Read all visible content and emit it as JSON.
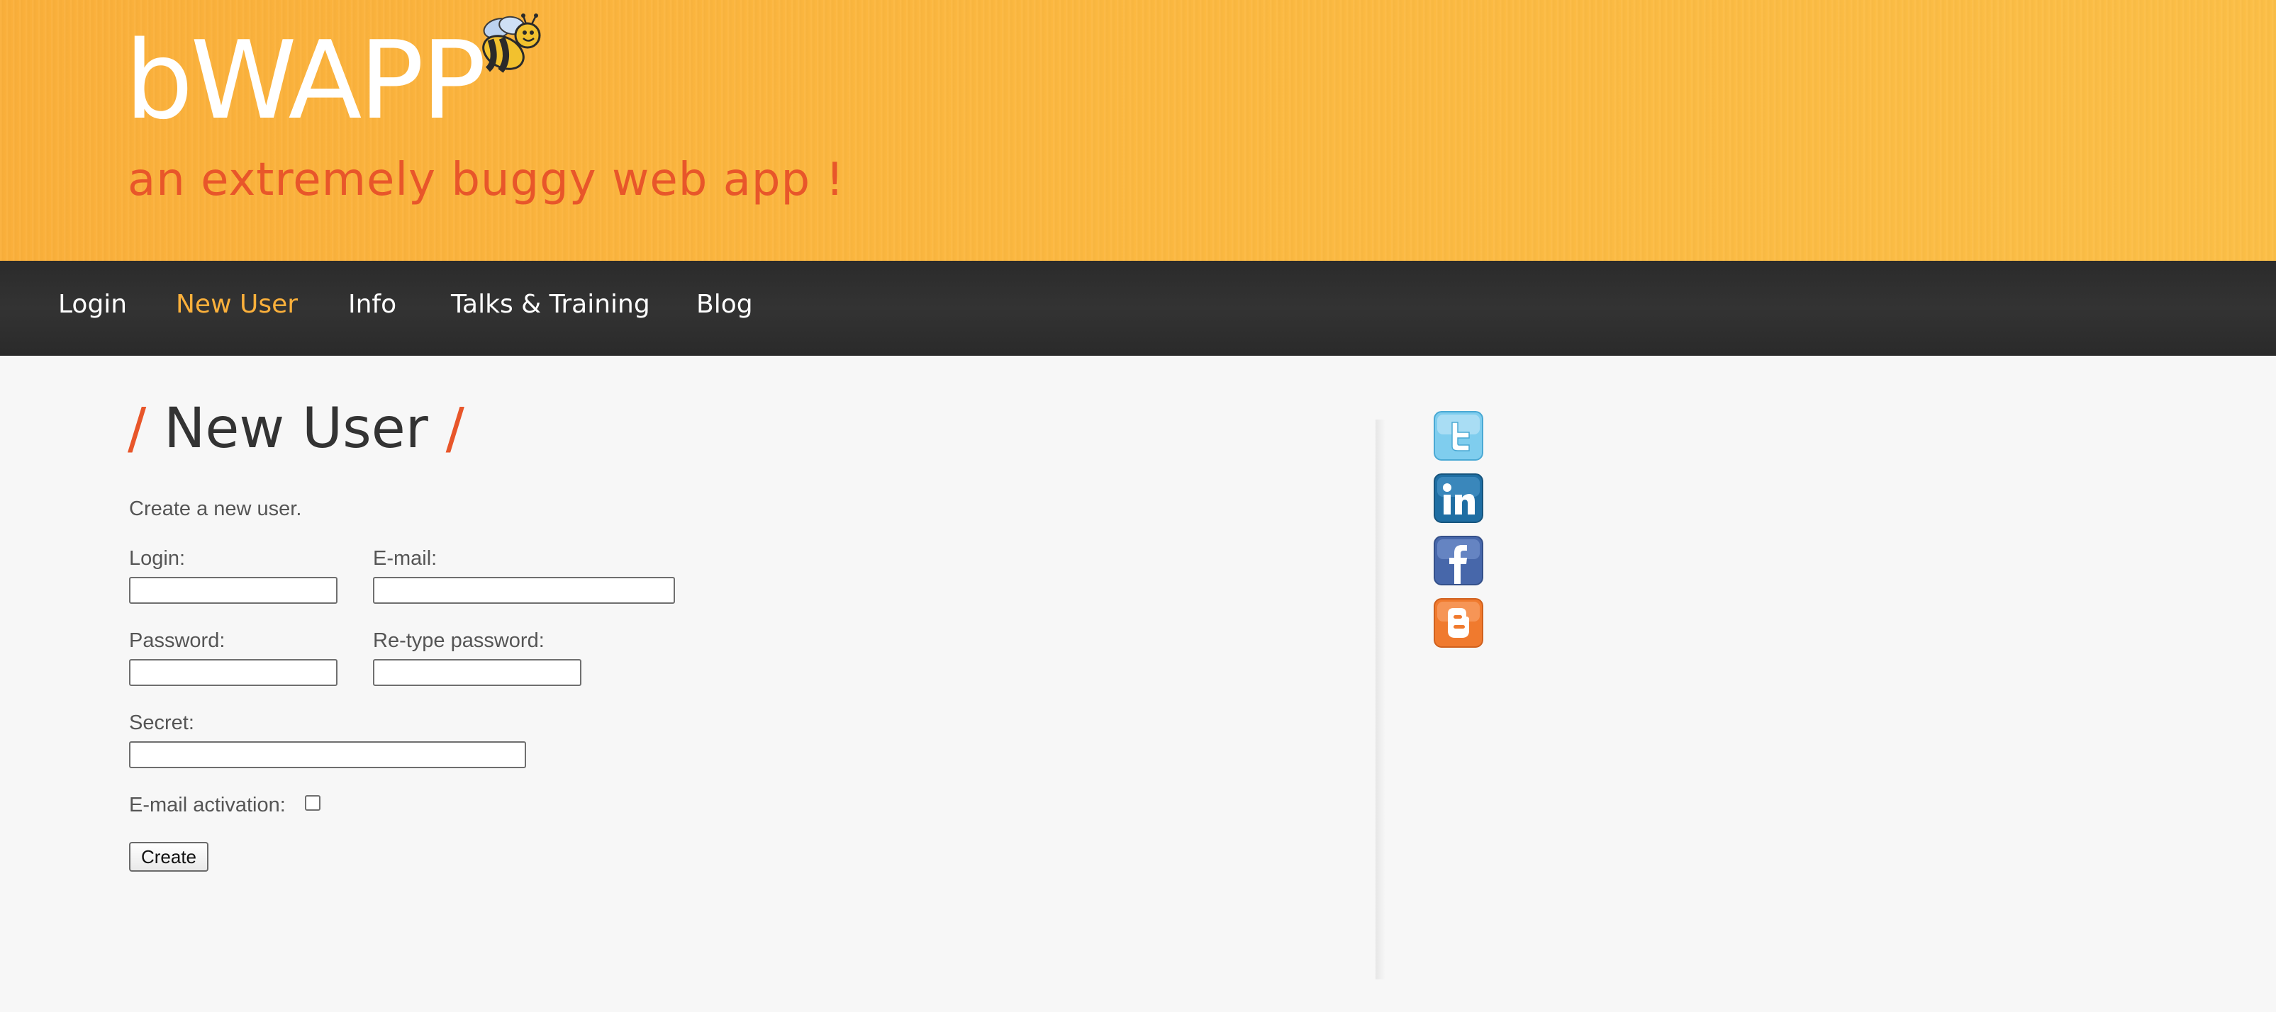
{
  "header": {
    "logo": "bWAPP",
    "tagline": "an extremely buggy web app !"
  },
  "nav": {
    "items": [
      {
        "label": "Login",
        "active": false
      },
      {
        "label": "New User",
        "active": true
      },
      {
        "label": "Info",
        "active": false
      },
      {
        "label": "Talks & Training",
        "active": false
      },
      {
        "label": "Blog",
        "active": false
      }
    ]
  },
  "page": {
    "title": "New User",
    "slash": "/",
    "intro": "Create a new user."
  },
  "form": {
    "login_label": "Login:",
    "login_value": "",
    "email_label": "E-mail:",
    "email_value": "",
    "password_label": "Password:",
    "password_value": "",
    "retype_label": "Re-type password:",
    "retype_value": "",
    "secret_label": "Secret:",
    "secret_value": "",
    "activation_label": "E-mail activation:",
    "activation_checked": false,
    "create_label": "Create"
  },
  "social": {
    "icons": [
      "twitter-icon",
      "linkedin-icon",
      "facebook-icon",
      "blogger-icon"
    ]
  },
  "colors": {
    "header_orange": "#fbb03b",
    "accent_red": "#e8562a",
    "nav_dark": "#2f2f2f",
    "nav_active": "#fbb03b"
  }
}
